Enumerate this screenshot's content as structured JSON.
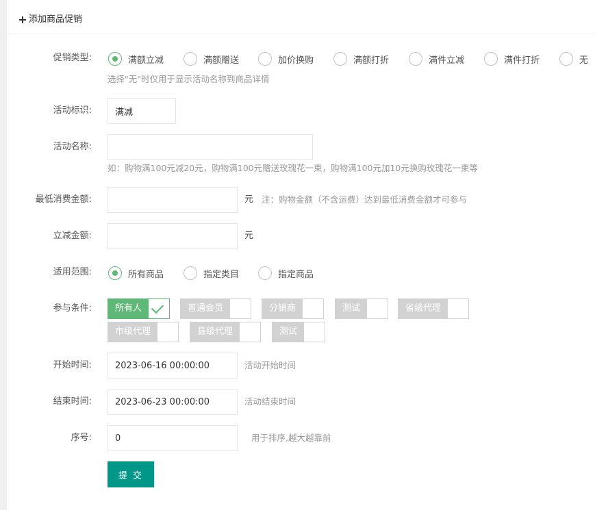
{
  "header": {
    "title": "添加商品促销"
  },
  "promo_type": {
    "label": "促销类型:",
    "options": [
      "满额立减",
      "满额赠送",
      "加价换购",
      "满额打折",
      "满件立减",
      "满件打折",
      "无"
    ],
    "selected": "满额立减",
    "hint": "选择\"无\"时仅用于显示活动名称到商品详情"
  },
  "activity_tag": {
    "label": "活动标识:",
    "value": "满减"
  },
  "activity_name": {
    "label": "活动名称:",
    "value": "",
    "hint": "如：购物满100元减20元，购物满100元赠送玫瑰花一束，购物满100元加10元换购玫瑰花一束等"
  },
  "min_amount": {
    "label": "最低消费金额:",
    "value": "",
    "unit": "元",
    "hint": "注：购物金额（不含运费）达到最低消费金额才可参与"
  },
  "discount_amount": {
    "label": "立减金额:",
    "value": "",
    "unit": "元"
  },
  "scope": {
    "label": "适用范围:",
    "options": [
      "所有商品",
      "指定类目",
      "指定商品"
    ],
    "selected": "所有商品"
  },
  "conditions": {
    "label": "参与条件:",
    "options": [
      {
        "text": "所有人",
        "checked": true
      },
      {
        "text": "普通会员",
        "checked": false
      },
      {
        "text": "分销商",
        "checked": false
      },
      {
        "text": "测试",
        "checked": false
      },
      {
        "text": "省级代理",
        "checked": false
      },
      {
        "text": "市级代理",
        "checked": false
      },
      {
        "text": "县级代理",
        "checked": false
      },
      {
        "text": "测试",
        "checked": false
      }
    ]
  },
  "start_time": {
    "label": "开始时间:",
    "value": "2023-06-16 00:00:00",
    "hint": "活动开始时间"
  },
  "end_time": {
    "label": "结束时间:",
    "value": "2023-06-23 00:00:00",
    "hint": "活动结束时间"
  },
  "sort": {
    "label": "序号:",
    "value": "0",
    "hint": "用于排序,越大越靠前"
  },
  "submit_label": "提 交",
  "colors": {
    "accent": "#5FB878",
    "primary_button": "#009688",
    "inactive_tag": "#d2d2d2"
  }
}
